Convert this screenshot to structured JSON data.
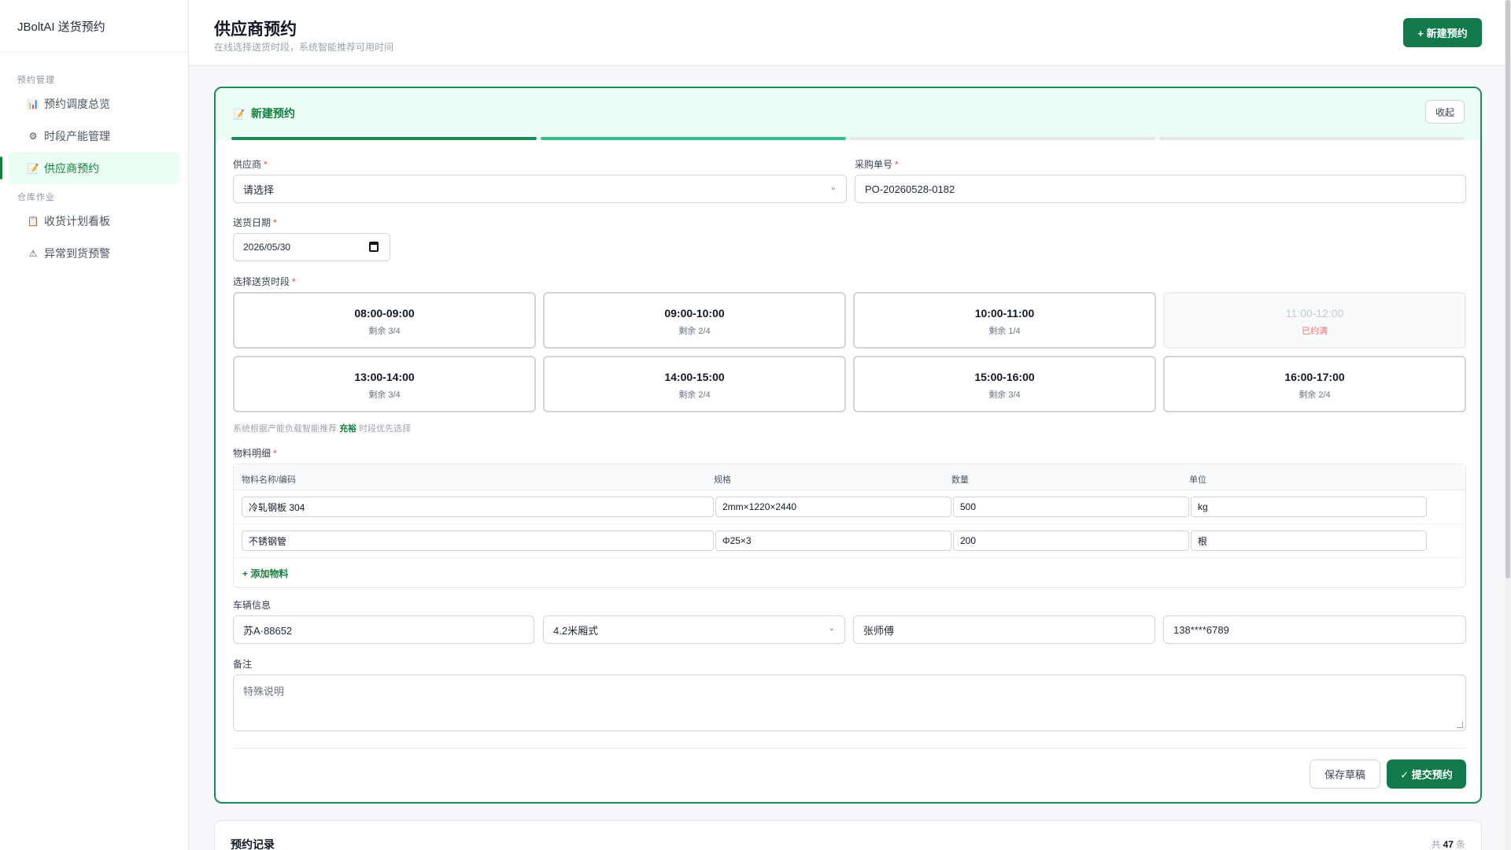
{
  "sidebar": {
    "brand": "JBoltAI 送货预约",
    "group1": "预约管理",
    "group2": "仓库作业",
    "items": [
      {
        "icon": "📊",
        "label": "预约调度总览"
      },
      {
        "icon": "⚙",
        "label": "时段产能管理"
      },
      {
        "icon": "📝",
        "label": "供应商预约"
      },
      {
        "icon": "📋",
        "label": "收货计划看板"
      },
      {
        "icon": "⚠",
        "label": "异常到货预警"
      }
    ]
  },
  "header": {
    "title": "供应商预约",
    "subtitle": "在线选择送货时段，系统智能推荐可用时间",
    "new_button": "+ 新建预约"
  },
  "form": {
    "title": "新建预约",
    "title_icon": "📝",
    "collapse": "收起",
    "supplier_label": "供应商",
    "supplier_value": "请选择",
    "po_label": "采购单号",
    "po_value": "PO-20260528-0182",
    "date_label": "送货日期",
    "date_value": "2026/05/30",
    "slot_label": "选择送货时段",
    "slots": [
      {
        "time": "08:00-09:00",
        "remain": "剩余 3/4"
      },
      {
        "time": "09:00-10:00",
        "remain": "剩余 2/4"
      },
      {
        "time": "10:00-11:00",
        "remain": "剩余 1/4"
      },
      {
        "time": "11:00-12:00",
        "remain": "已约满"
      },
      {
        "time": "13:00-14:00",
        "remain": "剩余 3/4"
      },
      {
        "time": "14:00-15:00",
        "remain": "剩余 2/4"
      },
      {
        "time": "15:00-16:00",
        "remain": "剩余 3/4"
      },
      {
        "time": "16:00-17:00",
        "remain": "剩余 2/4"
      }
    ],
    "hint_pre": "系统根据产能负载智能推荐",
    "hint_strong": "充裕",
    "hint_post": "时段优先选择",
    "materials_label": "物料明细",
    "mat_headers": [
      "物料名称/编码",
      "规格",
      "数量",
      "单位"
    ],
    "materials": [
      [
        "冷轧钢板 304",
        "2mm×1220×2440",
        "500",
        "kg"
      ],
      [
        "不锈钢管",
        "Φ25×3",
        "200",
        "根"
      ]
    ],
    "add_material": "+ 添加物料",
    "vehicle_label": "车辆信息",
    "plate": "苏A·88652",
    "vehicle_type": "4.2米厢式",
    "driver": "张师傅",
    "phone": "138****6789",
    "remark_label": "备注",
    "remark_placeholder": "特殊说明",
    "save_draft": "保存草稿",
    "submit": "✓ 提交预约"
  },
  "records": {
    "title": "预约记录",
    "count_pre": "共",
    "count": "47",
    "count_post": "条"
  },
  "colors": {
    "brand": "#12794a",
    "accent_light": "#ecfdf5",
    "danger": "#ef4444"
  }
}
